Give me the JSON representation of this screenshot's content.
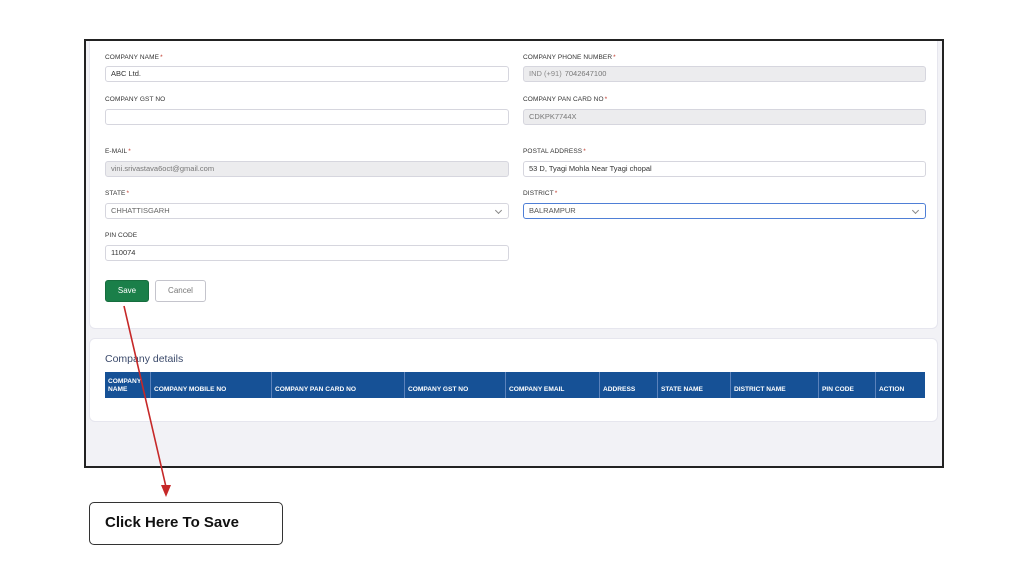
{
  "form": {
    "company_name": {
      "label": "COMPANY NAME",
      "value": "ABC Ltd."
    },
    "company_phone": {
      "label": "COMPANY PHONE NUMBER",
      "prefix": "IND (+91)",
      "value": "7042647100"
    },
    "gst": {
      "label": "COMPANY GST NO",
      "value": ""
    },
    "pan": {
      "label": "COMPANY PAN CARD NO",
      "value": "CDKPK7744X"
    },
    "email": {
      "label": "E-MAIL",
      "value": "vini.srivastava6oct@gmail.com"
    },
    "postal": {
      "label": "POSTAL ADDRESS",
      "value": "53 D, Tyagi Mohla Near Tyagi chopal"
    },
    "state": {
      "label": "STATE",
      "value": "CHHATTISGARH"
    },
    "district": {
      "label": "DISTRICT",
      "value": "BALRAMPUR"
    },
    "pin": {
      "label": "PIN CODE",
      "value": "110074"
    },
    "required_mark": "*",
    "save_label": "Save",
    "cancel_label": "Cancel"
  },
  "details": {
    "title": "Company details",
    "columns": [
      "COMPANY NAME",
      "COMPANY MOBILE NO",
      "COMPANY PAN CARD NO",
      "COMPANY GST NO",
      "COMPANY EMAIL",
      "ADDRESS",
      "STATE NAME",
      "DISTRICT NAME",
      "PIN CODE",
      "ACTION"
    ]
  },
  "callout": {
    "text": "Click Here To Save"
  },
  "colors": {
    "save_button": "#1a7f49",
    "table_header": "#165196",
    "arrow": "#c62828",
    "required": "#c0392b"
  }
}
